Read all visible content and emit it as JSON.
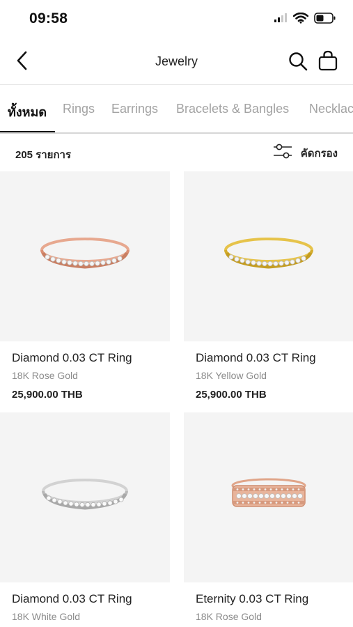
{
  "status_bar": {
    "time": "09:58",
    "icons": [
      "signal-icon",
      "wifi-icon",
      "battery-icon"
    ]
  },
  "header": {
    "title": "Jewelry",
    "icons": [
      "back-chevron-icon",
      "search-icon",
      "shopping-bag-icon"
    ]
  },
  "tabs": [
    {
      "label": "ทั้งหมด",
      "active": true
    },
    {
      "label": "Rings",
      "active": false
    },
    {
      "label": "Earrings",
      "active": false
    },
    {
      "label": "Bracelets & Bangles",
      "active": false
    },
    {
      "label": "Necklac",
      "active": false
    }
  ],
  "results": {
    "count_label": "205 รายการ",
    "filter_label": "คัดกรอง",
    "filter_icon": "sliders-icon"
  },
  "products": [
    {
      "name": "Diamond 0.03 CT Ring",
      "material": "18K Rose Gold",
      "price": "25,900.00 THB",
      "metal_color": "#e7a88f",
      "image_icon": "rose-gold-ring-image"
    },
    {
      "name": "Diamond 0.03 CT Ring",
      "material": "18K Yellow Gold",
      "price": "25,900.00 THB",
      "metal_color": "#e6c34a",
      "image_icon": "yellow-gold-ring-image"
    },
    {
      "name": "Diamond 0.03 CT Ring",
      "material": "18K White Gold",
      "price": "",
      "metal_color": "#cfcfcf",
      "image_icon": "white-gold-ring-image"
    },
    {
      "name": "Eternity 0.03 CT Ring",
      "material": "18K Rose Gold",
      "price": "",
      "metal_color": "#e2a88c",
      "image_icon": "rose-gold-eternity-ring-image"
    }
  ],
  "colors": {
    "background": "#ffffff",
    "card_background": "#f4f4f4",
    "active_tab": "#111111",
    "inactive_tab": "#a3a3a3",
    "secondary_text": "#8a8a8a"
  }
}
